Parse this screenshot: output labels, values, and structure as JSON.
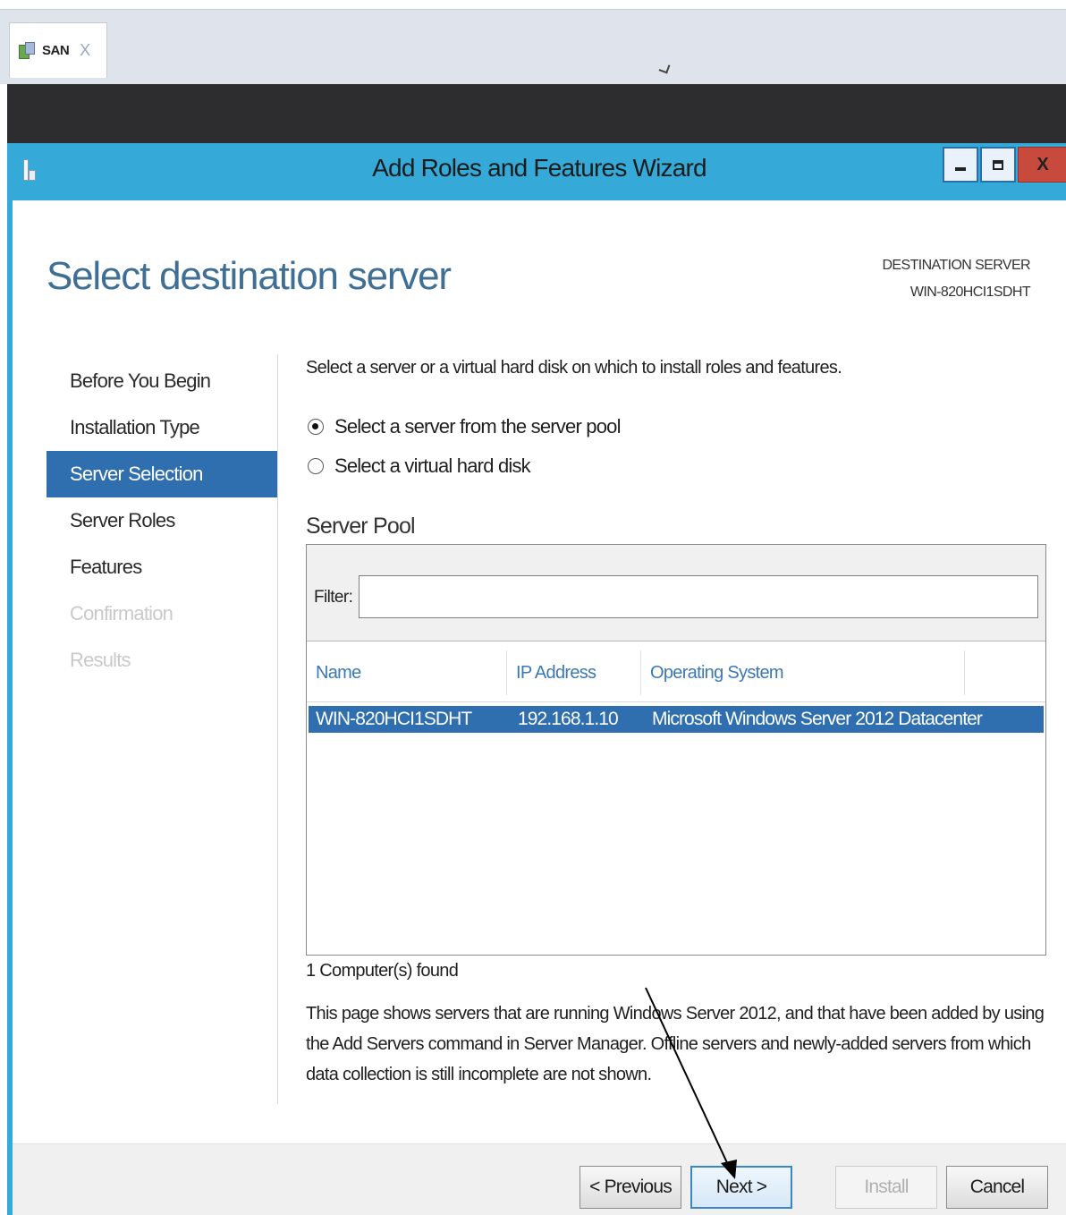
{
  "tab": {
    "label": "SAN",
    "close": "X"
  },
  "window": {
    "title": "Add Roles and Features Wizard",
    "close_label": "X"
  },
  "page": {
    "title": "Select destination server",
    "destination_label": "DESTINATION SERVER",
    "destination_server": "WIN-820HCI1SDHT"
  },
  "nav": {
    "items": [
      {
        "label": "Before You Begin",
        "state": "normal"
      },
      {
        "label": "Installation Type",
        "state": "normal"
      },
      {
        "label": "Server Selection",
        "state": "active"
      },
      {
        "label": "Server Roles",
        "state": "normal"
      },
      {
        "label": "Features",
        "state": "normal"
      },
      {
        "label": "Confirmation",
        "state": "disabled"
      },
      {
        "label": "Results",
        "state": "disabled"
      }
    ]
  },
  "content": {
    "intro": "Select a server or a virtual hard disk on which to install roles and features.",
    "options": [
      {
        "label": "Select a server from the server pool",
        "selected": true
      },
      {
        "label": "Select a virtual hard disk",
        "selected": false
      }
    ],
    "pool_label": "Server Pool",
    "filter_label": "Filter:",
    "filter_value": "",
    "columns": [
      "Name",
      "IP Address",
      "Operating System"
    ],
    "rows": [
      {
        "name": "WIN-820HCI1SDHT",
        "ip": "192.168.1.10",
        "os": "Microsoft Windows Server 2012 Datacenter"
      }
    ],
    "found": "1 Computer(s) found",
    "note": "This page shows servers that are running Windows Server 2012, and that have been added by using the Add Servers command in Server Manager. Offline servers and newly-added servers from which data collection is still incomplete are not shown."
  },
  "buttons": {
    "previous": "< Previous",
    "next": "Next >",
    "install": "Install",
    "cancel": "Cancel"
  },
  "colors": {
    "titlebar": "#35a9d8",
    "selection": "#2f6faf",
    "heading": "#3f6f95"
  }
}
